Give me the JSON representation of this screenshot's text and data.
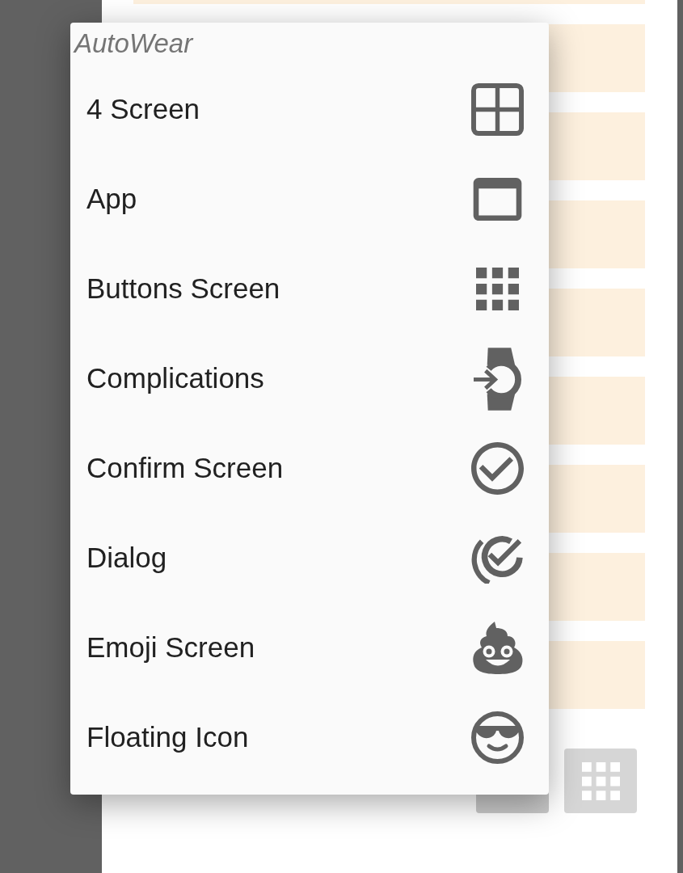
{
  "menu": {
    "title": "AutoWear",
    "items": [
      {
        "label": "4 Screen"
      },
      {
        "label": "App"
      },
      {
        "label": "Buttons Screen"
      },
      {
        "label": "Complications"
      },
      {
        "label": "Confirm Screen"
      },
      {
        "label": "Dialog"
      },
      {
        "label": "Emoji Screen"
      },
      {
        "label": "Floating Icon"
      }
    ]
  }
}
